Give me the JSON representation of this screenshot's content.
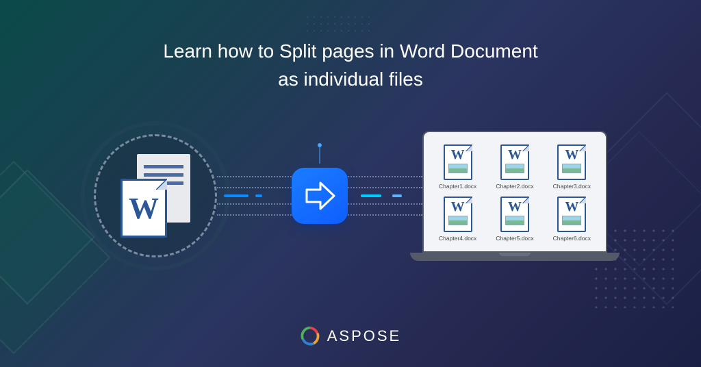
{
  "heading_line1": "Learn how to Split pages in Word Document",
  "heading_line2": "as individual files",
  "source_letter": "W",
  "files": [
    {
      "letter": "W",
      "name": "Chapter1.docx"
    },
    {
      "letter": "W",
      "name": "Chapter2.docx"
    },
    {
      "letter": "W",
      "name": "Chapter3.docx"
    },
    {
      "letter": "W",
      "name": "Chapter4.docx"
    },
    {
      "letter": "W",
      "name": "Chapter5.docx"
    },
    {
      "letter": "W",
      "name": "Chapter6.docx"
    }
  ],
  "brand": "ASPOSE"
}
